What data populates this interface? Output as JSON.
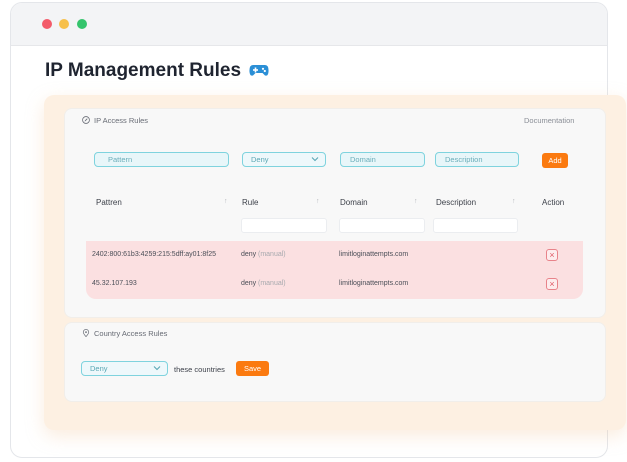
{
  "page": {
    "title": "IP Management Rules"
  },
  "ip_rules": {
    "section_title": "IP Access Rules",
    "documentation_link": "Documentation",
    "form": {
      "pattern_placeholder": "Pattern",
      "rule_value": "Deny",
      "domain_placeholder": "Domain",
      "description_placeholder": "Description",
      "add_label": "Add"
    },
    "columns": [
      "Pattren",
      "Rule",
      "Domain",
      "Description",
      "Action"
    ],
    "rows": [
      {
        "pattern": "2402:800:61b3:4259:215:5dff:ay01:8f25",
        "rule": "deny",
        "rule_note": "(manual)",
        "domain": "limitloginattempts.com",
        "description": ""
      },
      {
        "pattern": "45.32.107.193",
        "rule": "deny",
        "rule_note": "(manual)",
        "domain": "limitloginattempts.com",
        "description": ""
      }
    ]
  },
  "country_rules": {
    "section_title": "Country Access Rules",
    "rule_value": "Deny",
    "label": "these countries",
    "save_label": "Save"
  },
  "colors": {
    "accent": "#fb7a10",
    "teal": "#7fd3de",
    "row_deny": "#fbe0e1"
  }
}
